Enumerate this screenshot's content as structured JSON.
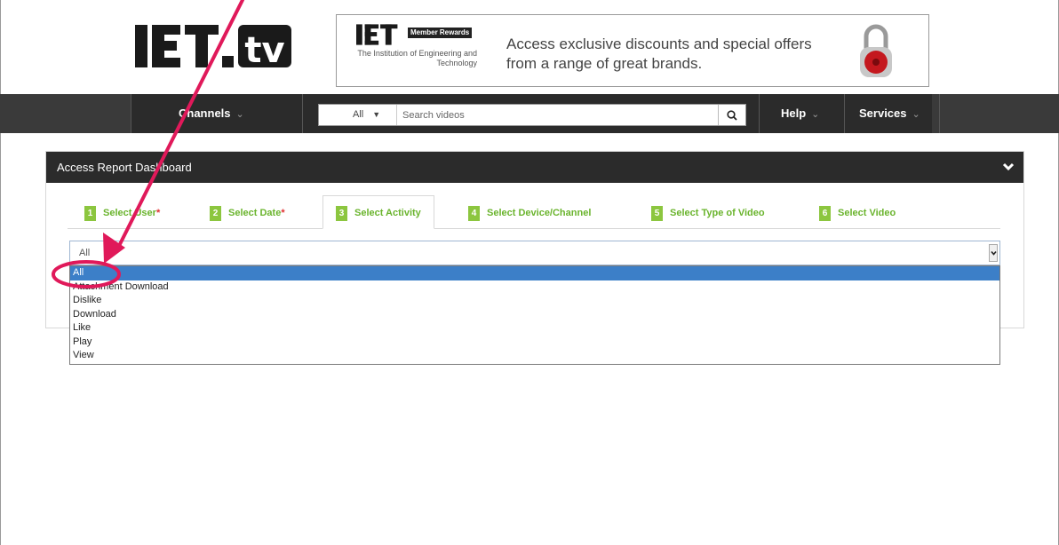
{
  "header": {
    "logo_text": "IET.tv",
    "banner": {
      "badge": "Member Rewards",
      "institution": "The Institution of Engineering and Technology",
      "line1": "Access exclusive discounts and special offers",
      "line2": "from a range of great brands."
    }
  },
  "nav": {
    "channels_label": "Channels",
    "search_scope": "All",
    "search_placeholder": "Search videos",
    "help_label": "Help",
    "services_label": "Services"
  },
  "dashboard": {
    "title": "Access Report Dashboard",
    "tabs": [
      {
        "num": "1",
        "label": "Select User",
        "required": "*"
      },
      {
        "num": "2",
        "label": "Select Date",
        "required": "*"
      },
      {
        "num": "3",
        "label": "Select Activity"
      },
      {
        "num": "4",
        "label": "Select Device/Channel"
      },
      {
        "num": "5",
        "label": "Select Type of Video"
      },
      {
        "num": "6",
        "label": "Select Video"
      }
    ],
    "activity_select": {
      "value": "All",
      "options": [
        "All",
        "Attachment Download",
        "Dislike",
        "Download",
        "Like",
        "Play",
        "View"
      ],
      "selected_index": 0
    }
  },
  "colors": {
    "nav_bg": "#3a3a3a",
    "tab_green": "#6ab42d",
    "badge_green": "#8cc63f",
    "selection_blue": "#3c7fc8",
    "annotation_pink": "#e0195a"
  }
}
